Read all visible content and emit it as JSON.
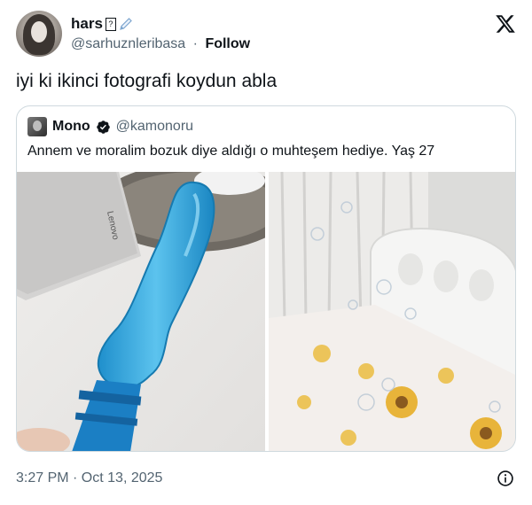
{
  "author": {
    "display_name": "hars",
    "name_emoji": "🖊",
    "handle": "@sarhuznleribasa",
    "separator": "·",
    "follow_label": "Follow"
  },
  "tweet": {
    "text": "iyi ki ikinci fotografi koydun abla"
  },
  "quoted": {
    "display_name": "Mono",
    "handle": "@kamonoru",
    "text": "Annem ve moralim bozuk diye aldığı o muhteşem hediye. Yaş 27",
    "laptop_brand": "Lenovo"
  },
  "footer": {
    "timestamp": "3:27 PM · Oct 13, 2025"
  },
  "colors": {
    "text_primary": "#0f1419",
    "text_secondary": "#536471",
    "verified_blue": "#1d9bf0",
    "border": "#cfd9de",
    "toy_blue": "#2a9fd8"
  }
}
